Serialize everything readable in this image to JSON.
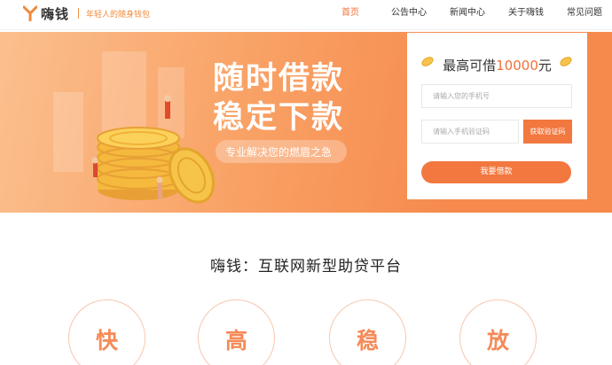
{
  "header": {
    "brand_name": "嗨钱",
    "slogan": "年轻人的随身钱包",
    "nav": [
      {
        "label": "首页",
        "active": true
      },
      {
        "label": "公告中心",
        "active": false
      },
      {
        "label": "新闻中心",
        "active": false
      },
      {
        "label": "关于嗨钱",
        "active": false
      },
      {
        "label": "常见问题",
        "active": false
      }
    ]
  },
  "banner": {
    "headline_line1": "随时借款",
    "headline_line2": "稳定下款",
    "subheadline": "专业解决您的燃眉之急"
  },
  "loan_form": {
    "title_prefix": "最高可借",
    "title_amount": "10000",
    "title_suffix": "元",
    "phone_placeholder": "请输入您的手机号",
    "code_placeholder": "请输入手机验证码",
    "get_code_label": "获取验证码",
    "submit_label": "我要借款"
  },
  "features": {
    "title": "嗨钱：互联网新型助贷平台",
    "items": [
      "快",
      "高",
      "稳",
      "放"
    ]
  },
  "colors": {
    "accent": "#f2783f",
    "banner_light": "#fbbf8e",
    "banner_dark": "#f68a4d",
    "coin": "#f7c44b"
  }
}
